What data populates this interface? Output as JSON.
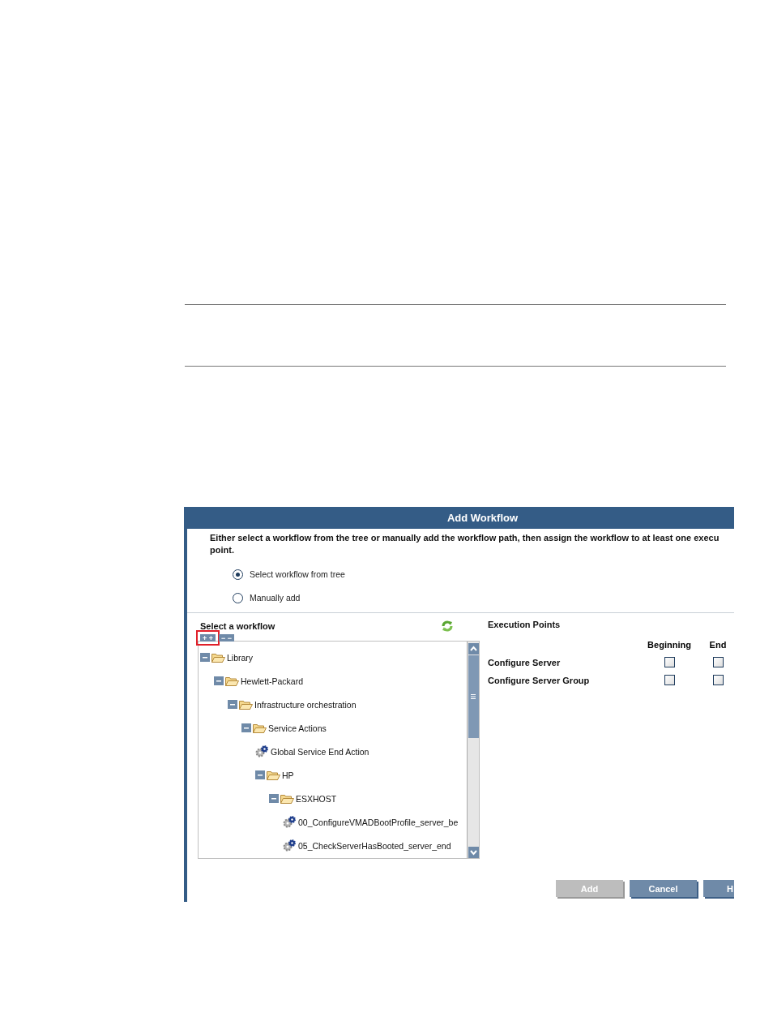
{
  "dialog": {
    "title": "Add Workflow",
    "description": [
      "Either select a workflow from the tree or manually add the workflow path, then assign the workflow to at least one execu",
      "point."
    ],
    "radios": [
      {
        "label": "Select workflow from tree",
        "selected": true
      },
      {
        "label": "Manually add",
        "selected": false
      }
    ],
    "workflow_panel": {
      "title": "Select a workflow",
      "tree_buttons": [
        {
          "label": "+ +",
          "highlighted": true
        },
        {
          "label": "− −",
          "highlighted": false
        }
      ],
      "tree": [
        {
          "label": "Library",
          "kind": "folder",
          "expanded": true,
          "children": [
            {
              "label": "Hewlett-Packard",
              "kind": "folder",
              "expanded": true,
              "children": [
                {
                  "label": "Infrastructure orchestration",
                  "kind": "folder",
                  "expanded": true,
                  "children": [
                    {
                      "label": "Service Actions",
                      "kind": "folder",
                      "expanded": true,
                      "children": [
                        {
                          "label": "Global Service End Action",
                          "kind": "workflow"
                        },
                        {
                          "label": "HP",
                          "kind": "folder",
                          "expanded": true,
                          "children": [
                            {
                              "label": "ESXHOST",
                              "kind": "folder",
                              "expanded": true,
                              "children": [
                                {
                                  "label": "00_ConfigureVMADBootProfile_server_be",
                                  "kind": "workflow"
                                },
                                {
                                  "label": "05_CheckServerHasBooted_server_end",
                                  "kind": "workflow"
                                }
                              ]
                            }
                          ]
                        }
                      ]
                    }
                  ]
                }
              ]
            }
          ]
        }
      ]
    },
    "execution_points": {
      "title": "Execution Points",
      "columns": [
        "Beginning",
        "End"
      ],
      "rows": [
        {
          "label": "Configure Server",
          "checks": [
            false,
            false
          ]
        },
        {
          "label": "Configure Server Group",
          "checks": [
            false,
            false
          ]
        }
      ]
    },
    "buttons": [
      {
        "label": "Add",
        "disabled": true
      },
      {
        "label": "Cancel",
        "disabled": false
      },
      {
        "label": "H",
        "disabled": false
      }
    ]
  }
}
